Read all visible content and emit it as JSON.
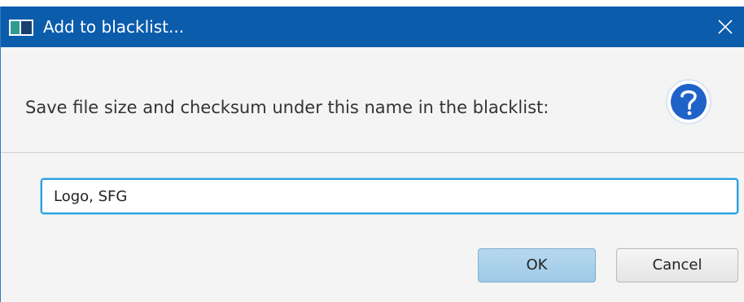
{
  "window": {
    "title": "Add to blacklist..."
  },
  "dialog": {
    "message": "Save file size and checksum under this name in the blacklist:",
    "icon": "question-icon",
    "name_input_value": "Logo, SFG"
  },
  "buttons": {
    "ok_label": "OK",
    "cancel_label": "Cancel"
  },
  "colors": {
    "titlebar": "#0b5cab",
    "question_icon": "#1f63c9",
    "input_focus_border": "#2ca0db",
    "ok_button": "#a9d1ea"
  }
}
